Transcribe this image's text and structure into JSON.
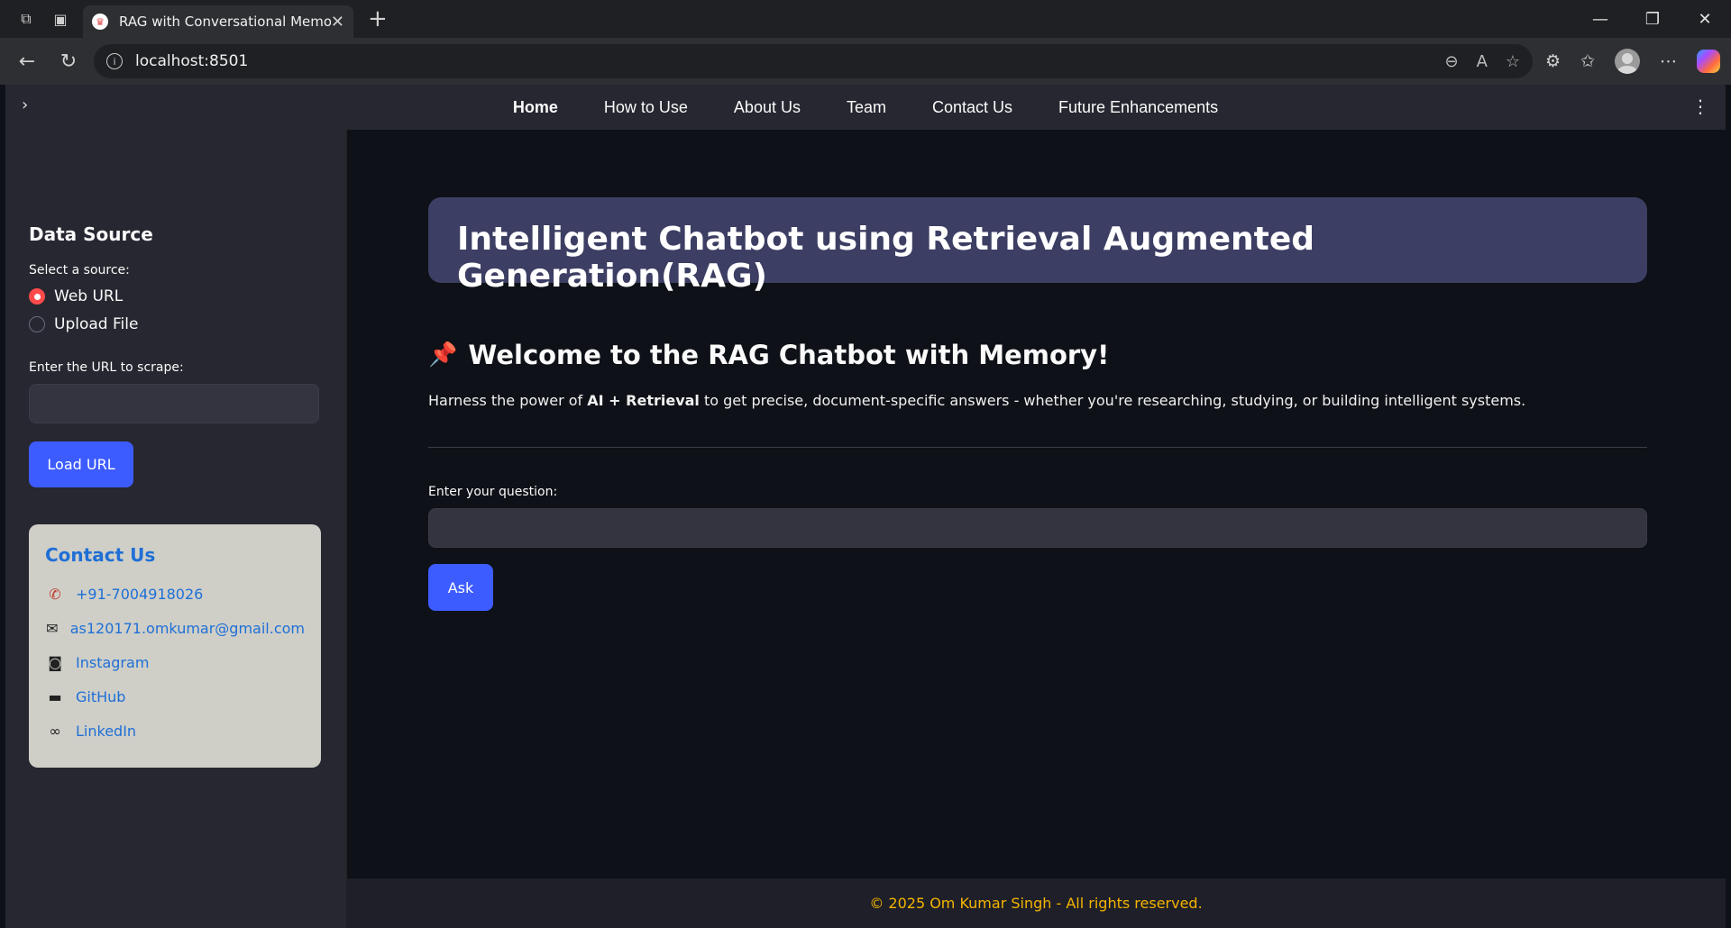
{
  "browser": {
    "tab_title": "RAG with Conversational Memory",
    "url": "localhost:8501"
  },
  "nav": {
    "items": [
      {
        "label": "Home",
        "active": true
      },
      {
        "label": "How to Use"
      },
      {
        "label": "About Us"
      },
      {
        "label": "Team"
      },
      {
        "label": "Contact Us"
      },
      {
        "label": "Future Enhancements"
      }
    ]
  },
  "sidebar": {
    "heading": "Data Source",
    "select_label": "Select a source:",
    "options": [
      "Web URL",
      "Upload File"
    ],
    "selected": "Web URL",
    "url_label": "Enter the URL to scrape:",
    "url_value": "",
    "load_label": "Load URL",
    "contact": {
      "title": "Contact Us",
      "phone": "+91-7004918026",
      "email": "as120171.omkumar@gmail.com",
      "instagram": "Instagram",
      "github": "GitHub",
      "linkedin": "LinkedIn"
    }
  },
  "main": {
    "banner_title": "Intelligent Chatbot using Retrieval Augmented Generation(RAG)",
    "welcome": "Welcome to the RAG Chatbot with Memory!",
    "desc_prefix": "Harness the power of ",
    "desc_bold": "AI + Retrieval",
    "desc_suffix": " to get precise, document-specific answers - whether you're researching, studying, or building intelligent systems.",
    "question_label": "Enter your question:",
    "question_value": "",
    "ask_label": "Ask"
  },
  "footer": {
    "text": "© 2025 Om Kumar Singh - All rights reserved."
  },
  "colors": {
    "accent": "#3d5cff",
    "radio_selected": "#ff4b4b",
    "link": "#1f6fd6",
    "footer_text": "#f5b400"
  }
}
